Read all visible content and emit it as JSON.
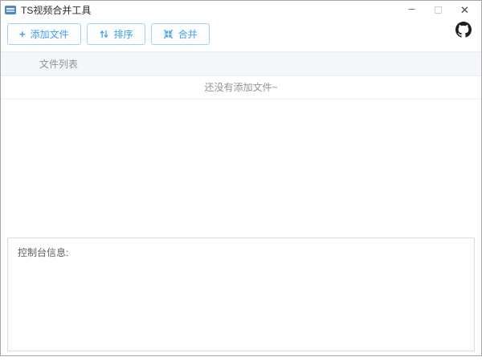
{
  "window": {
    "title": "TS视频合并工具",
    "icons": {
      "minimize": "─",
      "close": "✕"
    }
  },
  "toolbar": {
    "add_button": {
      "label": "添加文件",
      "plus_glyph": "+"
    },
    "sort_button": {
      "label": "排序"
    },
    "merge_button": {
      "label": "合并"
    }
  },
  "file_table": {
    "header": "文件列表",
    "empty_text": "还没有添加文件~"
  },
  "console": {
    "label": "控制台信息:"
  },
  "colors": {
    "accent": "#409eff",
    "button_border": "#a3d0fd",
    "header_bg": "#f5f6f8",
    "muted_text": "#909399",
    "panel_border": "#d9dce3",
    "github_icon": "#1b1f23"
  }
}
